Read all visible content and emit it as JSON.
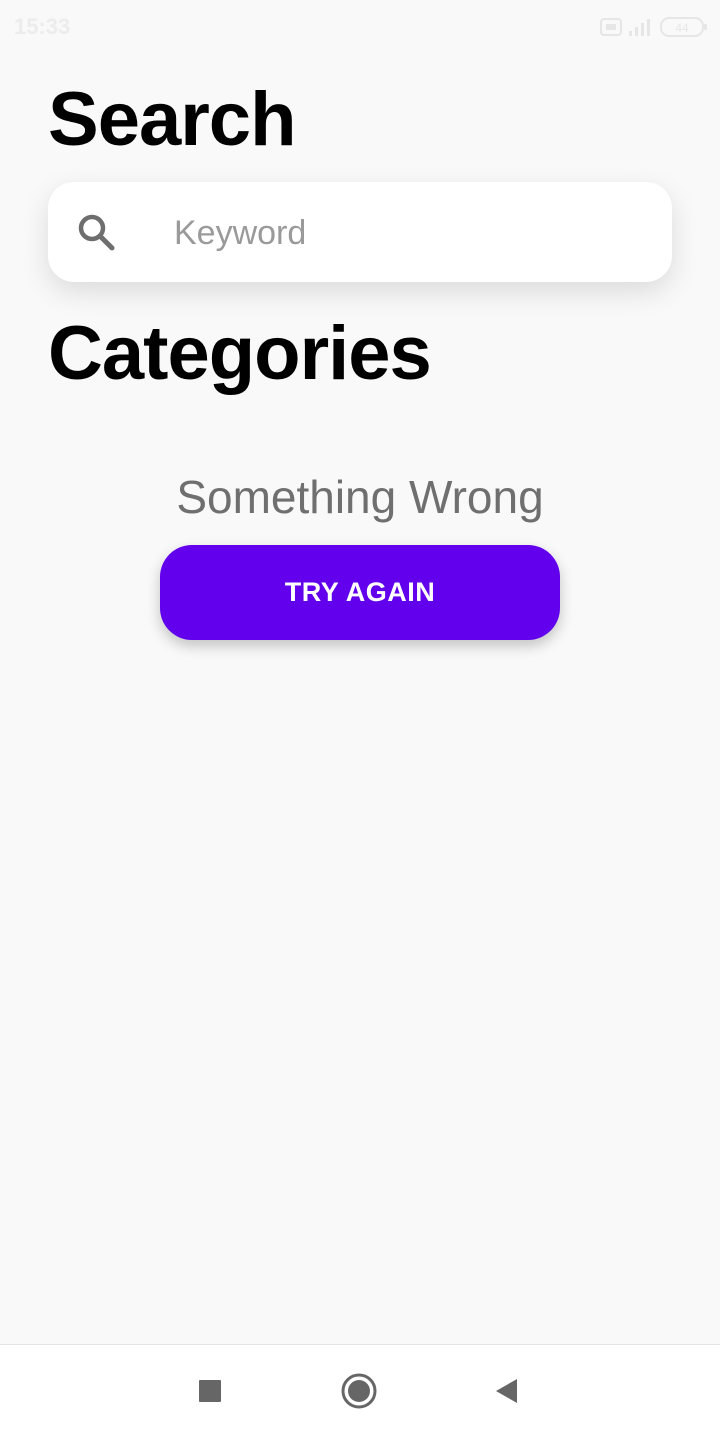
{
  "status_bar": {
    "time": "15:33",
    "battery": "44"
  },
  "search": {
    "heading": "Search",
    "placeholder": "Keyword",
    "icon": "search-icon"
  },
  "categories": {
    "heading": "Categories",
    "error_message": "Something Wrong",
    "retry_label": "TRY AGAIN"
  },
  "nav_bar": {
    "icons": [
      "recents-icon",
      "home-icon",
      "back-icon"
    ]
  },
  "colors": {
    "accent": "#6200ee",
    "background": "#f9f9f9",
    "error_text": "#6f6f6f"
  }
}
